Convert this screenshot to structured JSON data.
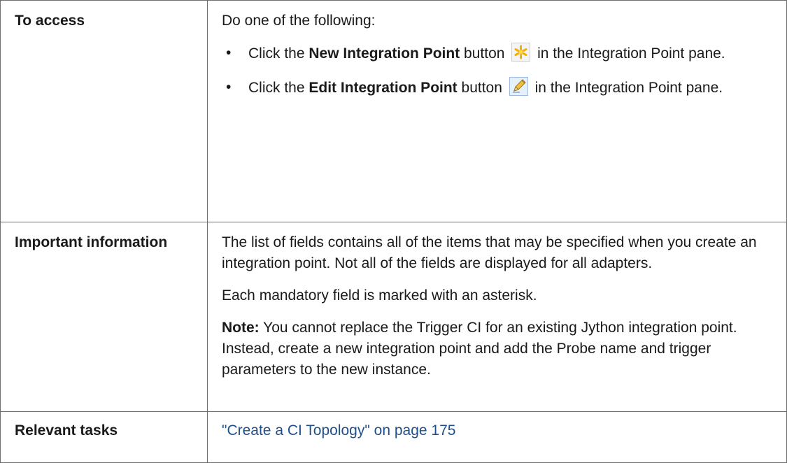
{
  "rows": {
    "access": {
      "label": "To access",
      "intro": "Do one of the following:",
      "items": [
        {
          "pre": "Click the ",
          "bold": "New Integration Point",
          "mid": " button",
          "icon": "new-star-icon",
          "post": " in the Integration Point pane."
        },
        {
          "pre": "Click the ",
          "bold": "Edit Integration Point",
          "mid": " button",
          "icon": "edit-pencil-icon",
          "post": " in the Integration Point pane."
        }
      ]
    },
    "important": {
      "label": "Important information",
      "para1": "The list of fields contains all of the items that may be specified when you create an integration point. Not all of the fields are displayed for all adapters.",
      "para2": "Each mandatory field is marked with an asterisk.",
      "note_label": "Note:",
      "note_text": " You cannot replace the Trigger CI for an existing Jython integration point. Instead, create a new integration point and add the Probe name and trigger parameters to the new instance."
    },
    "relevant": {
      "label": "Relevant tasks",
      "link_text": "\"Create a CI Topology\" on page 175"
    }
  },
  "colors": {
    "link": "#1f4f8b",
    "border": "#6e6e6e",
    "star_icon": "#f2b100"
  }
}
